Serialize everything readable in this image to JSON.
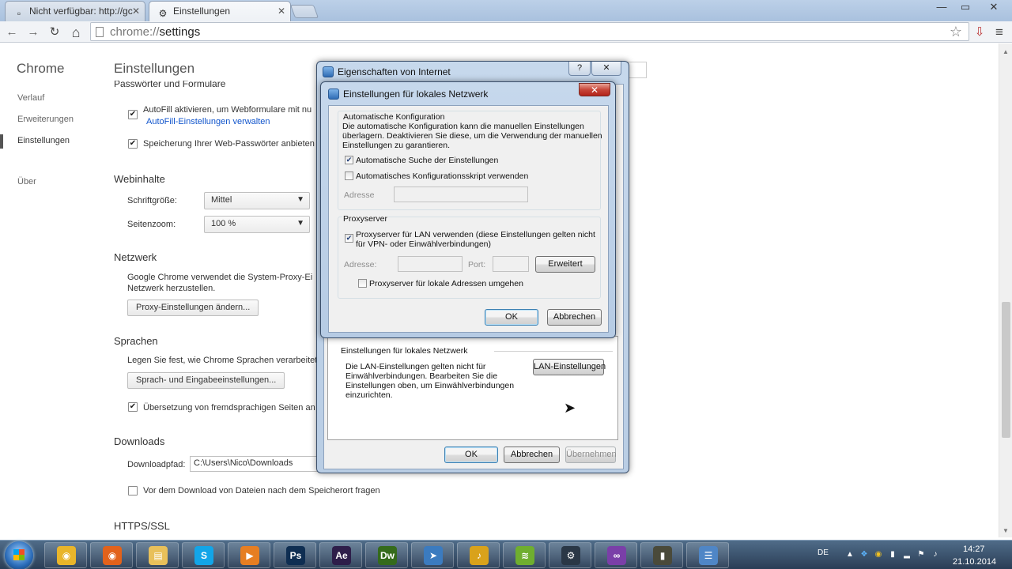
{
  "tabs": [
    {
      "label": "Nicht verfügbar: http://gc",
      "icon": "page-icon"
    },
    {
      "label": "Einstellungen",
      "icon": "gear-icon"
    }
  ],
  "window_controls": {
    "minimize": "—",
    "maximize": "▭",
    "close": "✕"
  },
  "toolbar": {
    "back": "←",
    "forward": "→",
    "reload": "↻",
    "home": "⌂",
    "url_scheme": "chrome://",
    "url_path": "settings",
    "star": "☆",
    "menu": "≡"
  },
  "sidebar": {
    "title": "Chrome",
    "items": [
      {
        "label": "Verlauf"
      },
      {
        "label": "Erweiterungen"
      },
      {
        "label": "Einstellungen"
      },
      {
        "label": "Über"
      }
    ]
  },
  "settings": {
    "title": "Einstellungen",
    "cut_section": "Passwörter und Formulare",
    "autofill_label": "AutoFill aktivieren, um Webformulare mit nu",
    "autofill_link": "AutoFill-Einstellungen verwalten",
    "passwords_label": "Speicherung Ihrer Web-Passwörter anbieten",
    "web_content_head": "Webinhalte",
    "font_size_label": "Schriftgröße:",
    "font_size_value": "Mittel",
    "zoom_label": "Seitenzoom:",
    "zoom_value": "100 %",
    "network_head": "Netzwerk",
    "network_text_1": "Google Chrome verwendet die System-Proxy-Ei",
    "network_text_2": "Netzwerk herzustellen.",
    "proxy_button": "Proxy-Einstellungen ändern...",
    "languages_head": "Sprachen",
    "languages_text": "Legen Sie fest, wie Chrome Sprachen verarbeitet",
    "languages_button": "Sprach- und Eingabeeinstellungen...",
    "translate_label": "Übersetzung von fremdsprachigen Seiten an",
    "downloads_head": "Downloads",
    "download_path_label": "Downloadpfad:",
    "download_path_value": "C:\\Users\\Nico\\Downloads",
    "ask_location_label": "Vor dem Download von Dateien nach dem Speicherort fragen",
    "https_head": "HTTPS/SSL"
  },
  "inet_dialog": {
    "title": "Eigenschaften von Internet",
    "help": "?",
    "close": "✕",
    "lan_section_title": "Einstellungen für lokales Netzwerk",
    "lan_text_1": "Die LAN-Einstellungen gelten nicht für",
    "lan_text_2": "Einwählverbindungen. Bearbeiten Sie die",
    "lan_text_3": "Einstellungen oben, um Einwählverbindungen",
    "lan_text_4": "einzurichten.",
    "lan_button": "LAN-Einstellungen",
    "ok": "OK",
    "cancel": "Abbrechen",
    "apply": "Übernehmen"
  },
  "lan_dialog": {
    "title": "Einstellungen für lokales Netzwerk",
    "close": "✕",
    "auto_config_head": "Automatische Konfiguration",
    "auto_config_text_1": "Die automatische Konfiguration kann die manuellen Einstellungen",
    "auto_config_text_2": "überlagern. Deaktivieren Sie diese, um die Verwendung der manuellen",
    "auto_config_text_3": "Einstellungen zu garantieren.",
    "auto_detect_label": "Automatische Suche der Einstellungen",
    "auto_detect_checked": true,
    "auto_script_label": "Automatisches Konfigurationsskript verwenden",
    "auto_script_checked": false,
    "address_label": "Adresse",
    "proxy_head": "Proxyserver",
    "use_proxy_label_1": "Proxyserver für LAN verwenden (diese Einstellungen gelten nicht",
    "use_proxy_label_2": "für VPN- oder Einwählverbindungen)",
    "use_proxy_checked": true,
    "proxy_address_label": "Adresse:",
    "port_label": "Port:",
    "advanced_button": "Erweitert",
    "bypass_label": "Proxyserver für lokale Adressen umgehen",
    "bypass_checked": false,
    "ok": "OK",
    "cancel": "Abbrechen"
  },
  "taskbar": {
    "apps": [
      {
        "name": "chrome",
        "glyph": "◉",
        "color": "#e9b52a"
      },
      {
        "name": "firefox",
        "glyph": "◉",
        "color": "#e2621b"
      },
      {
        "name": "explorer",
        "glyph": "▤",
        "color": "#e8c05a"
      },
      {
        "name": "skype",
        "glyph": "S",
        "color": "#12a5e8"
      },
      {
        "name": "media-player",
        "glyph": "▶",
        "color": "#e67e22"
      },
      {
        "name": "photoshop",
        "glyph": "Ps",
        "color": "#0f2e52"
      },
      {
        "name": "after-effects",
        "glyph": "Ae",
        "color": "#2e1e4a"
      },
      {
        "name": "dreamweaver",
        "glyph": "Dw",
        "color": "#356b1c"
      },
      {
        "name": "shortcut-app",
        "glyph": "➤",
        "color": "#3b7bbf"
      },
      {
        "name": "fl-studio",
        "glyph": "♪",
        "color": "#d9a21b"
      },
      {
        "name": "spotify",
        "glyph": "≋",
        "color": "#6fae2f"
      },
      {
        "name": "steam",
        "glyph": "⚙",
        "color": "#2a3746"
      },
      {
        "name": "visual-studio",
        "glyph": "∞",
        "color": "#7a3fa8"
      },
      {
        "name": "gpu-tool",
        "glyph": "▮",
        "color": "#4a4a3a"
      },
      {
        "name": "internet-options",
        "glyph": "☰",
        "color": "#4f86c6"
      }
    ],
    "lang": "DE",
    "time": "14:27",
    "date": "21.10.2014"
  }
}
